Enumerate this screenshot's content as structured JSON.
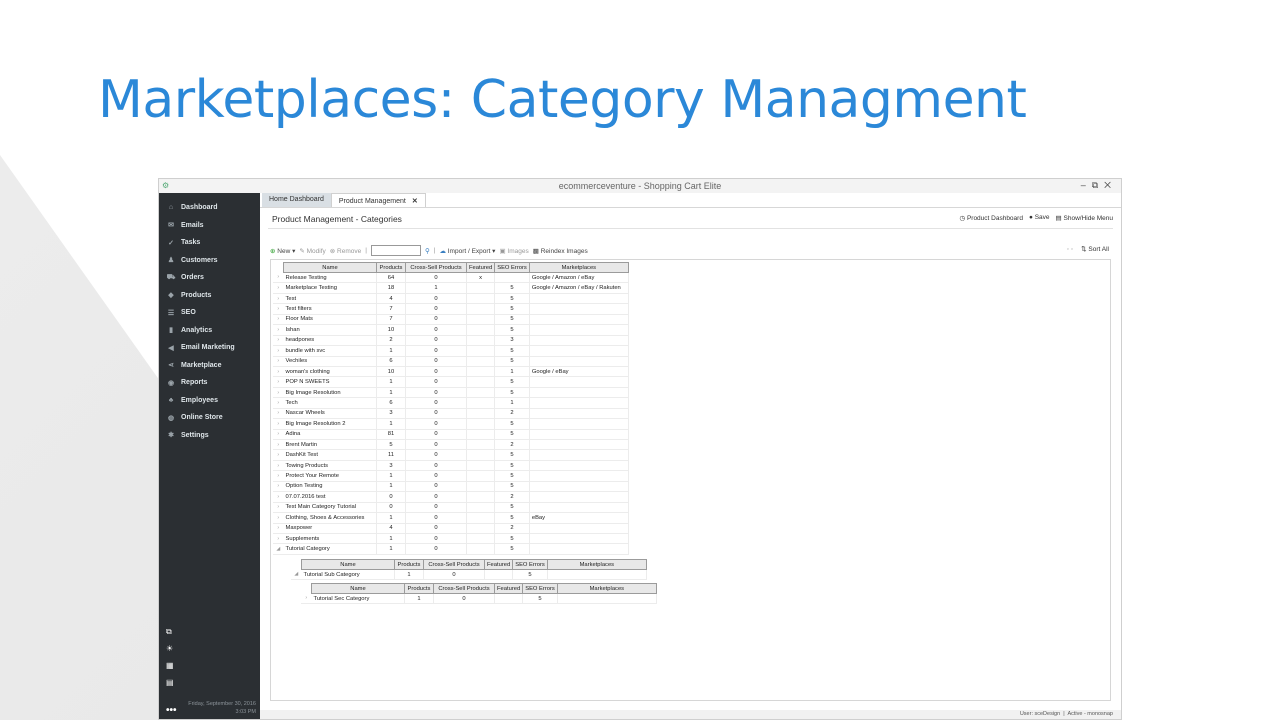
{
  "slide": {
    "title": "Marketplaces: Category Managment"
  },
  "window": {
    "title": "ecommerceventure - Shopping Cart Elite",
    "minimize": "–",
    "restore": "⧉",
    "close": "✕"
  },
  "sidebar": {
    "items": [
      {
        "label": "Dashboard",
        "icon": "home-icon"
      },
      {
        "label": "Emails",
        "icon": "mail-icon"
      },
      {
        "label": "Tasks",
        "icon": "tasks-icon"
      },
      {
        "label": "Customers",
        "icon": "user-icon"
      },
      {
        "label": "Orders",
        "icon": "cart-icon"
      },
      {
        "label": "Products",
        "icon": "tag-icon"
      },
      {
        "label": "SEO",
        "icon": "seo-icon"
      },
      {
        "label": "Analytics",
        "icon": "bar-chart-icon"
      },
      {
        "label": "Email Marketing",
        "icon": "megaphone-icon"
      },
      {
        "label": "Marketplace",
        "icon": "share-icon"
      },
      {
        "label": "Reports",
        "icon": "reports-icon"
      },
      {
        "label": "Employees",
        "icon": "employees-icon"
      },
      {
        "label": "Online Store",
        "icon": "globe-icon"
      },
      {
        "label": "Settings",
        "icon": "gear-icon"
      }
    ],
    "date_line1": "Friday, September 30, 2016",
    "date_line2": "3:03 PM",
    "more": "•••"
  },
  "tabs": [
    {
      "label": "Home Dashboard",
      "active": false
    },
    {
      "label": "Product Management",
      "active": true,
      "close": "✕"
    }
  ],
  "page": {
    "title": "Product Management - Categories",
    "actions": {
      "dashboard": "Product Dashboard",
      "save": "Save",
      "menu": "Show/Hide Menu"
    }
  },
  "toolbar": {
    "new": "New",
    "modify": "Modify",
    "remove": "Remove",
    "import_export": "Import / Export",
    "images": "Images",
    "reindex": "Reindex Images",
    "sort_all": "Sort All"
  },
  "grid": {
    "columns": [
      "Name",
      "Products",
      "Cross-Sell Products",
      "Featured",
      "SEO Errors",
      "Marketplaces"
    ],
    "rows": [
      [
        "Release Testing",
        "64",
        "0",
        "x",
        "",
        "Google / Amazon / eBay"
      ],
      [
        "Marketplace Testing",
        "18",
        "1",
        "",
        "5",
        "Google / Amazon / eBay / Rakuten"
      ],
      [
        "Test",
        "4",
        "0",
        "",
        "5",
        ""
      ],
      [
        "Test filters",
        "7",
        "0",
        "",
        "5",
        ""
      ],
      [
        "Floor Mats",
        "7",
        "0",
        "",
        "5",
        ""
      ],
      [
        "Ishan",
        "10",
        "0",
        "",
        "5",
        ""
      ],
      [
        "headpones",
        "2",
        "0",
        "",
        "3",
        ""
      ],
      [
        "bundle with svc",
        "1",
        "0",
        "",
        "5",
        ""
      ],
      [
        "Vechiles",
        "6",
        "0",
        "",
        "5",
        ""
      ],
      [
        "woman's clothing",
        "10",
        "0",
        "",
        "1",
        "Google / eBay"
      ],
      [
        "POP N SWEETS",
        "1",
        "0",
        "",
        "5",
        ""
      ],
      [
        "Big Image Resolution",
        "1",
        "0",
        "",
        "5",
        ""
      ],
      [
        "Tech",
        "6",
        "0",
        "",
        "1",
        ""
      ],
      [
        "Nascar Wheels",
        "3",
        "0",
        "",
        "2",
        ""
      ],
      [
        "Big Image Resolution 2",
        "1",
        "0",
        "",
        "5",
        ""
      ],
      [
        "Adina",
        "81",
        "0",
        "",
        "5",
        ""
      ],
      [
        "Brent Martin",
        "5",
        "0",
        "",
        "2",
        ""
      ],
      [
        "DashKit Test",
        "11",
        "0",
        "",
        "5",
        ""
      ],
      [
        "Towing Products",
        "3",
        "0",
        "",
        "5",
        ""
      ],
      [
        "Protect Your Remote",
        "1",
        "0",
        "",
        "5",
        ""
      ],
      [
        "Option Testing",
        "1",
        "0",
        "",
        "5",
        ""
      ],
      [
        "07.07.2016 test",
        "0",
        "0",
        "",
        "2",
        ""
      ],
      [
        "Test Main Category Tutorial",
        "0",
        "0",
        "",
        "5",
        ""
      ],
      [
        "Clothing, Shoes & Accessories",
        "1",
        "0",
        "",
        "5",
        "eBay"
      ],
      [
        "Maxpower",
        "4",
        "0",
        "",
        "2",
        ""
      ],
      [
        "Supplements",
        "1",
        "0",
        "",
        "5",
        ""
      ],
      [
        "Tutorial Category",
        "1",
        "0",
        "",
        "5",
        ""
      ]
    ],
    "sub": {
      "columns": [
        "Name",
        "Products",
        "Cross-Sell Products",
        "Featured",
        "SEO Errors",
        "Marketplaces"
      ],
      "rows": [
        [
          "Tutorial Sub Category",
          "1",
          "0",
          "",
          "5",
          ""
        ]
      ]
    },
    "subsub": {
      "columns": [
        "Name",
        "Products",
        "Cross-Sell Products",
        "Featured",
        "SEO Errors",
        "Marketplaces"
      ],
      "rows": [
        [
          "Tutorial Sec Category",
          "1",
          "0",
          "",
          "5",
          ""
        ]
      ]
    }
  },
  "status": {
    "user": "User: sceDesign",
    "active": "Active - monosnap"
  }
}
